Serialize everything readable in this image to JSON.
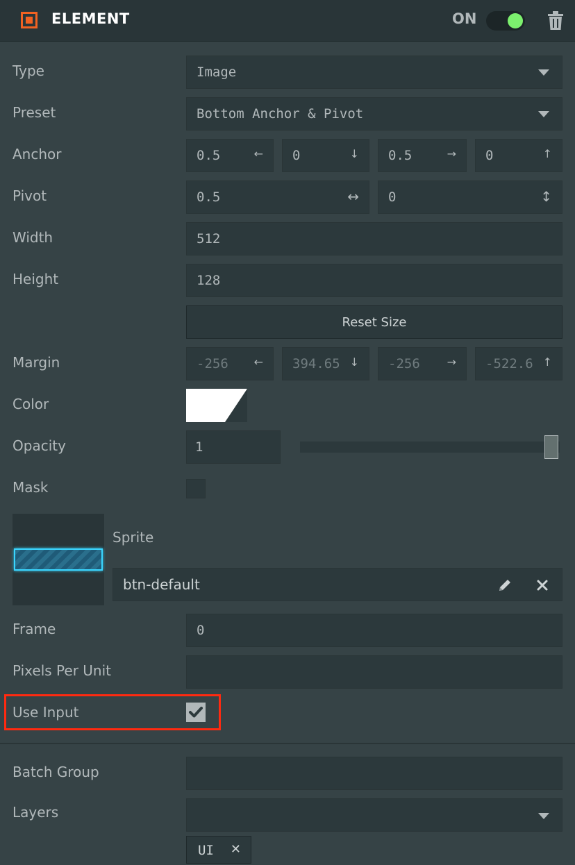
{
  "header": {
    "title": "ELEMENT",
    "toggle_label": "ON",
    "icon": "element-icon",
    "accent_color": "#f26222",
    "toggle_color": "#7cf06e",
    "enabled": true
  },
  "type": {
    "label": "Type",
    "value": "Image"
  },
  "preset": {
    "label": "Preset",
    "value": "Bottom Anchor & Pivot"
  },
  "anchor": {
    "label": "Anchor",
    "values": [
      "0.5",
      "0",
      "0.5",
      "0"
    ],
    "glyphs": [
      "←",
      "↓",
      "→",
      "↑"
    ]
  },
  "pivot": {
    "label": "Pivot",
    "values": [
      "0.5",
      "0"
    ],
    "glyphs": [
      "↔",
      "↕"
    ]
  },
  "width": {
    "label": "Width",
    "value": "512"
  },
  "height": {
    "label": "Height",
    "value": "128"
  },
  "reset_size": {
    "label": "Reset Size"
  },
  "margin": {
    "label": "Margin",
    "values": [
      "-256",
      "394.65",
      "-256",
      "-522.6"
    ],
    "glyphs": [
      "←",
      "↓",
      "→",
      "↑"
    ]
  },
  "color": {
    "label": "Color",
    "value": "#ffffff"
  },
  "opacity": {
    "label": "Opacity",
    "value": "1",
    "slider_fraction": 1.0
  },
  "mask": {
    "label": "Mask",
    "checked": false
  },
  "sprite": {
    "label": "Sprite",
    "value": "btn-default"
  },
  "frame": {
    "label": "Frame",
    "value": "0"
  },
  "pixels_per_unit": {
    "label": "Pixels Per Unit",
    "value": ""
  },
  "use_input": {
    "label": "Use Input",
    "checked": true,
    "checkmark": "✔"
  },
  "batch_group": {
    "label": "Batch Group",
    "value": ""
  },
  "layers": {
    "label": "Layers",
    "value": "",
    "tags": [
      {
        "text": "UI",
        "remove": "✕"
      }
    ]
  }
}
